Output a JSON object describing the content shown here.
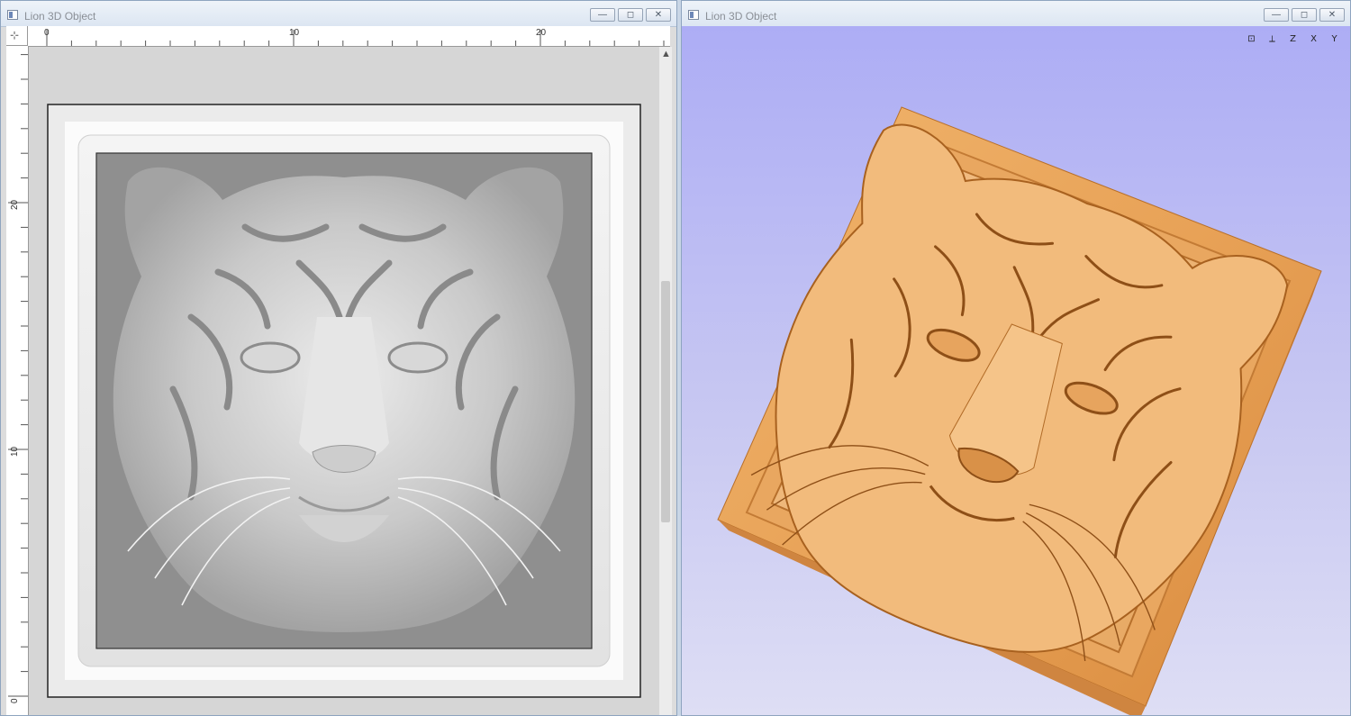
{
  "windows": {
    "left": {
      "title": "Lion 3D Object",
      "controls": {
        "minimize": "—",
        "restore": "◻",
        "close": "✕"
      }
    },
    "right": {
      "title": "Lion 3D Object",
      "controls": {
        "minimize": "—",
        "restore": "◻",
        "close": "✕"
      }
    }
  },
  "ruler": {
    "x_labels": [
      "0",
      "10",
      "20"
    ],
    "y_labels": [
      "20",
      "10",
      "0"
    ]
  },
  "view_tools": [
    {
      "icon": "fit-view-icon",
      "glyph": "⊡"
    },
    {
      "icon": "iso-view-icon",
      "glyph": "⟂"
    },
    {
      "icon": "view-z-icon",
      "glyph": "Z"
    },
    {
      "icon": "view-x-icon",
      "glyph": "X"
    },
    {
      "icon": "view-y-icon",
      "glyph": "Y"
    }
  ],
  "colors": {
    "wood": "#e6a45c",
    "relief_gray": "#9a9a9a",
    "background_3d": "#b4b4f4"
  }
}
